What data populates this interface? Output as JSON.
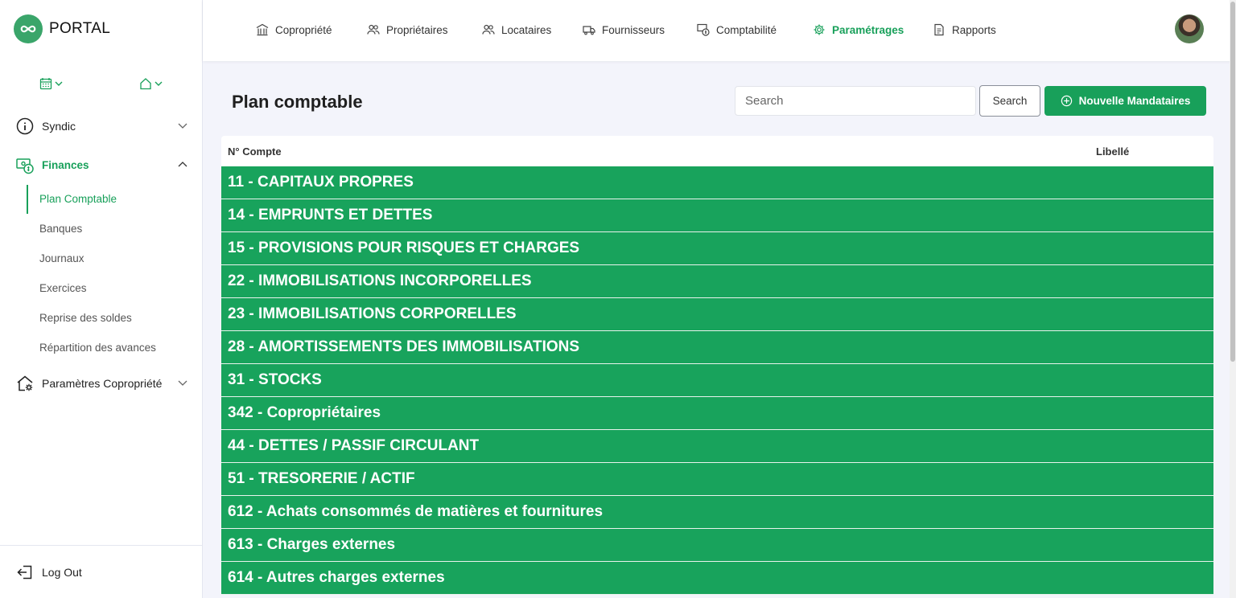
{
  "brand": {
    "name": "PORTAL",
    "logo_icon": "infinity-icon"
  },
  "selectors": {
    "calendar_icon": "calendar-icon",
    "home_icon": "home-icon"
  },
  "sidebar": {
    "items": [
      {
        "label": "Syndic",
        "icon": "info-icon"
      },
      {
        "label": "Finances",
        "icon": "money-icon"
      },
      {
        "label": "Paramètres Copropriété",
        "icon": "house-settings-icon"
      }
    ],
    "finances_sub": [
      "Plan Comptable",
      "Banques",
      "Journaux",
      "Exercices",
      "Reprise des soldes",
      "Répartition des avances"
    ],
    "logout": "Log Out"
  },
  "topnav": {
    "tabs": [
      {
        "label": "Copropriété",
        "icon": "building-icon"
      },
      {
        "label": "Propriétaires",
        "icon": "users-icon"
      },
      {
        "label": "Locataires",
        "icon": "users-icon"
      },
      {
        "label": "Fournisseurs",
        "icon": "truck-icon"
      },
      {
        "label": "Comptabilité",
        "icon": "accounting-icon"
      },
      {
        "label": "Paramétrages",
        "icon": "gear-icon"
      },
      {
        "label": "Rapports",
        "icon": "document-icon"
      }
    ],
    "active_tab": "Paramétrages"
  },
  "main": {
    "title": "Plan comptable",
    "search_placeholder": "Search",
    "search_button": "Search",
    "new_button": "Nouvelle Mandataires",
    "columns": [
      "N° Compte",
      "Libellé"
    ],
    "rows": [
      "11 - CAPITAUX PROPRES",
      "14 - EMPRUNTS ET DETTES",
      "15 - PROVISIONS POUR RISQUES ET CHARGES",
      "22 - IMMOBILISATIONS INCORPORELLES",
      "23 - IMMOBILISATIONS CORPORELLES",
      "28 - AMORTISSEMENTS DES IMMOBILISATIONS",
      "31 - STOCKS",
      "342 - Copropriétaires",
      "44 - DETTES / PASSIF CIRCULANT",
      "51 - TRESORERIE / ACTIF",
      "612 - Achats consommés de matières et fournitures",
      "613 - Charges externes",
      "614 - Autres charges externes"
    ]
  },
  "colors": {
    "accent": "#18a05a",
    "row_bg": "#18a35c",
    "page_bg": "#f3f4fb"
  }
}
